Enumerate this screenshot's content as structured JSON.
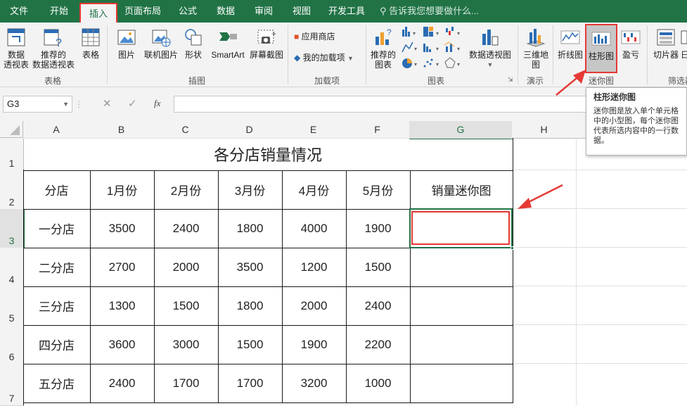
{
  "menu": {
    "tabs": [
      "文件",
      "开始",
      "插入",
      "页面布局",
      "公式",
      "数据",
      "审阅",
      "视图",
      "开发工具"
    ],
    "active": "插入",
    "tell_me": "告诉我您想要做什么..."
  },
  "ribbon": {
    "table_group": {
      "btn1": "数据透视表",
      "btn1_l1": "数据",
      "btn1_l2": "透视表",
      "btn2_l1": "推荐的",
      "btn2_l2": "数据透视表",
      "btn3": "表格",
      "label": "表格"
    },
    "illustration_group": {
      "pic": "图片",
      "online_pic": "联机图片",
      "shape": "形状",
      "smartart": "SmartArt",
      "screenshot": "屏幕截图",
      "label": "插图"
    },
    "addin_group": {
      "store": "应用商店",
      "my_addins": "我的加载项",
      "label": "加载项"
    },
    "chart_group": {
      "rec_l1": "推荐的",
      "rec_l2": "图表",
      "pivot_chart": "数据透视图",
      "label": "图表"
    },
    "tour_group": {
      "map_l1": "三维地",
      "map_l2": "图",
      "label": "演示"
    },
    "sparkline_group": {
      "line": "折线图",
      "column": "柱形图",
      "winloss": "盈亏",
      "label": "迷你图"
    },
    "filter_group": {
      "slicer": "切片器",
      "timeline": "日",
      "label": "筛选器"
    }
  },
  "formula_bar": {
    "name_box": "G3",
    "cancel": "✕",
    "enter": "✓",
    "fx": "fx"
  },
  "tooltip": {
    "title": "柱形迷你图",
    "body": "迷你图是放入单个单元格中的小型图，每个迷你图代表所选内容中的一行数据。"
  },
  "sheet": {
    "columns": [
      "A",
      "B",
      "C",
      "D",
      "E",
      "F",
      "G",
      "H"
    ],
    "rows": [
      "1",
      "2",
      "3",
      "4",
      "5",
      "6",
      "7"
    ],
    "title": "各分店销量情况",
    "headers": [
      "分店",
      "1月份",
      "2月份",
      "3月份",
      "4月份",
      "5月份",
      "销量迷你图"
    ],
    "data": [
      [
        "一分店",
        "3500",
        "2400",
        "1800",
        "4000",
        "1900",
        ""
      ],
      [
        "二分店",
        "2700",
        "2000",
        "3500",
        "1200",
        "1500",
        ""
      ],
      [
        "三分店",
        "1300",
        "1500",
        "1800",
        "2000",
        "2400",
        ""
      ],
      [
        "四分店",
        "3600",
        "3000",
        "1500",
        "1900",
        "2200",
        ""
      ],
      [
        "五分店",
        "2400",
        "1700",
        "1700",
        "3200",
        "1000",
        ""
      ]
    ]
  },
  "colors": {
    "accent": "#217346",
    "highlight": "#e53935"
  }
}
